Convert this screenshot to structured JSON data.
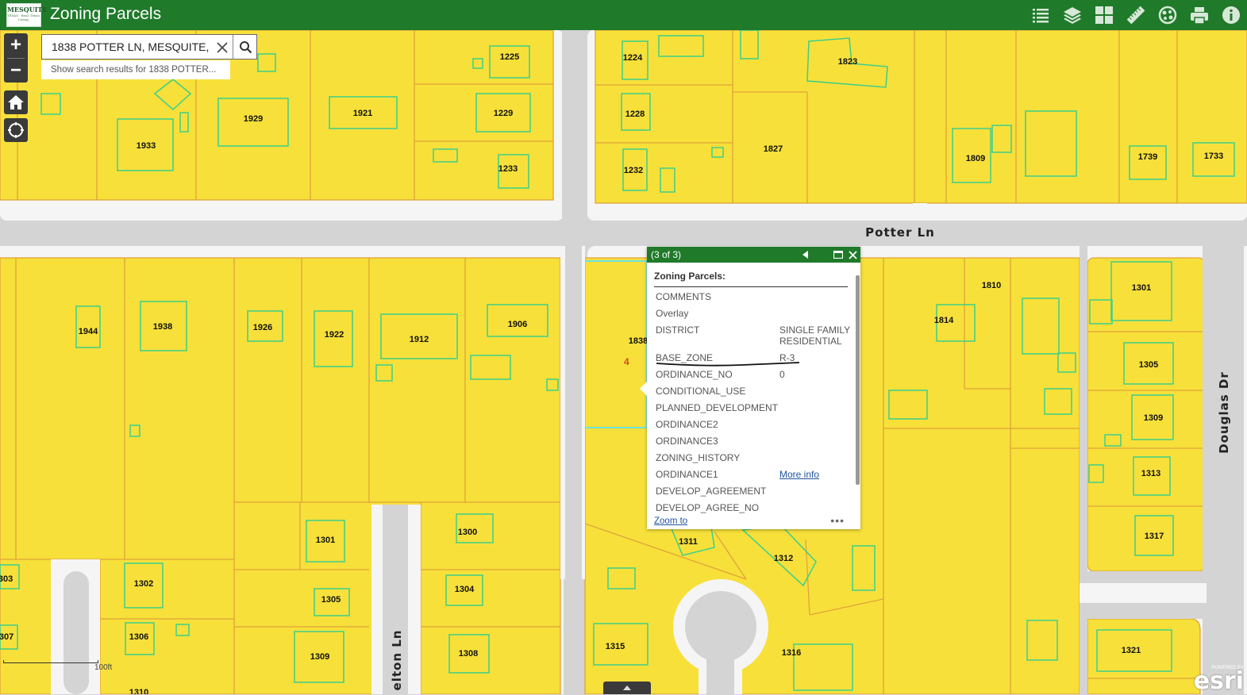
{
  "app": {
    "title": "Zoning Parcels",
    "logo_text": "MESQUITE",
    "logo_sub": "TEXAS · Real. Texas. Living."
  },
  "toolbar": {
    "tools": [
      {
        "name": "legend-icon"
      },
      {
        "name": "layers-icon"
      },
      {
        "name": "basemap-gallery-icon"
      },
      {
        "name": "measure-icon"
      },
      {
        "name": "draw-icon"
      },
      {
        "name": "print-icon"
      },
      {
        "name": "about-icon"
      }
    ]
  },
  "search": {
    "value": "1838 POTTER LN, MESQUITE,",
    "suggestion": "Show search results for 1838 POTTER..."
  },
  "popup": {
    "counter": "(3 of 3)",
    "section_title": "Zoning Parcels:",
    "fields": [
      {
        "key": "COMMENTS",
        "value": ""
      },
      {
        "key": "Overlay",
        "value": ""
      },
      {
        "key": "DISTRICT",
        "value": "SINGLE FAMILY RESIDENTIAL"
      },
      {
        "key": "BASE_ZONE",
        "value": "R-3"
      },
      {
        "key": "ORDINANCE_NO",
        "value": "0"
      },
      {
        "key": "CONDITIONAL_USE",
        "value": ""
      },
      {
        "key": "PLANNED_DEVELOPMENT",
        "value": ""
      },
      {
        "key": "ORDINANCE2",
        "value": ""
      },
      {
        "key": "ORDINANCE3",
        "value": ""
      },
      {
        "key": "ZONING_HISTORY",
        "value": ""
      },
      {
        "key": "ORDINANCE1",
        "value": "More info"
      },
      {
        "key": "DEVELOP_AGREEMENT",
        "value": ""
      },
      {
        "key": "DEVELOP_AGREE_NO",
        "value": ""
      }
    ],
    "zoom_label": "Zoom to",
    "more": "•••"
  },
  "map": {
    "streets": [
      "Potter Ln",
      "Douglas Dr",
      "elton Ln"
    ],
    "parcel_labels": [
      "1225",
      "1229",
      "1233",
      "1224",
      "1228",
      "1232",
      "1823",
      "1827",
      "1809",
      "1739",
      "1733",
      "1933",
      "1929",
      "1921",
      "1944",
      "1938",
      "1926",
      "1922",
      "1912",
      "1906",
      "1838",
      "4",
      "1810",
      "1814",
      "1301",
      "1305",
      "1309",
      "1313",
      "1317",
      "1321",
      "1300",
      "1304",
      "1308",
      "1301",
      "1305",
      "1309",
      "1302",
      "1306",
      "1311",
      "1312",
      "1315",
      "1316",
      "303",
      "307",
      "1310"
    ],
    "scale_label": "100ft",
    "esri_powered": "POWERED BY",
    "esri_name": "esri",
    "parcel_color": "#f7e03a",
    "parcel_outline_color": "#e0a33a",
    "building_color": "#3ccf8a",
    "road_color": "#d4d4d4",
    "selected_outline_color": "#6fe0e0",
    "annotation_color": "#d14a1e"
  }
}
